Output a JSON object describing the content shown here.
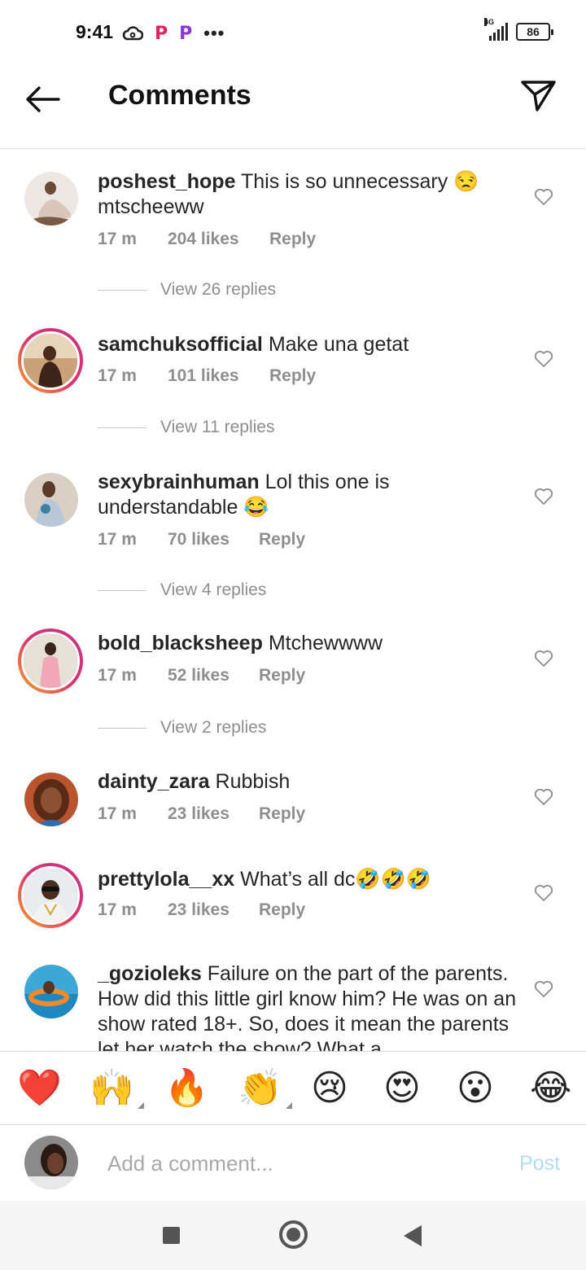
{
  "status_bar": {
    "time": "9:41",
    "network": "4G",
    "battery": "86",
    "more": "•••"
  },
  "header": {
    "title": "Comments"
  },
  "comments": [
    {
      "username": "poshest_hope",
      "text": "This is so unnecessary 😒 mtscheeww",
      "time": "17 m",
      "likes": "204 likes",
      "reply": "Reply",
      "view_replies": "View 26 replies",
      "story_ring": false
    },
    {
      "username": "samchuksofficial",
      "text": "Make una getat",
      "time": "17 m",
      "likes": "101 likes",
      "reply": "Reply",
      "view_replies": "View 11 replies",
      "story_ring": true
    },
    {
      "username": "sexybrainhuman",
      "text": "Lol this one is understandable 😂",
      "time": "17 m",
      "likes": "70 likes",
      "reply": "Reply",
      "view_replies": "View 4 replies",
      "story_ring": false
    },
    {
      "username": "bold_blacksheep",
      "text": "Mtchewwww",
      "time": "17 m",
      "likes": "52 likes",
      "reply": "Reply",
      "view_replies": "View 2 replies",
      "story_ring": true
    },
    {
      "username": "dainty_zara",
      "text": "Rubbish",
      "time": "17 m",
      "likes": "23 likes",
      "reply": "Reply",
      "story_ring": false
    },
    {
      "username": "prettylola__xx",
      "text": "What’s all dc🤣🤣🤣",
      "time": "17 m",
      "likes": "23 likes",
      "reply": "Reply",
      "story_ring": true
    },
    {
      "username": "_gozioleks",
      "text": "Failure on the part of the parents. How did this little girl know him? He was on an show rated 18+. So, does it mean the parents let her watch the show?  What a",
      "story_ring": false
    }
  ],
  "emoji_bar": [
    "❤️",
    "🙌",
    "🔥",
    "👏",
    "😢",
    "😍",
    "😮",
    "😂"
  ],
  "composer": {
    "placeholder": "Add a comment...",
    "post_label": "Post"
  }
}
